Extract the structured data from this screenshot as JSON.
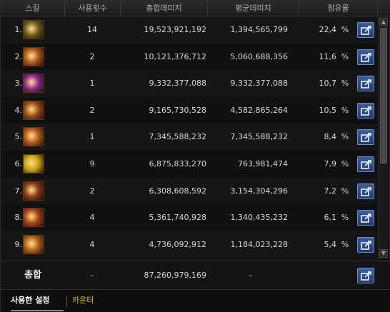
{
  "header": {
    "skill": "스킬",
    "count": "사용횟수",
    "total": "총합데미지",
    "avg": "평균데미지",
    "share": "점유율"
  },
  "rows": [
    {
      "rank": "1.",
      "count": "14",
      "total": "19,523,921,192",
      "avg": "1,394,565,799",
      "share": "22,4",
      "pct": "%",
      "icon": "skill-1-icon",
      "color": "#6b5a1a"
    },
    {
      "rank": "2.",
      "count": "2",
      "total": "10,121,376,712",
      "avg": "5,060,688,356",
      "share": "11,6",
      "pct": "%",
      "icon": "skill-2-icon",
      "color": "#b0561a"
    },
    {
      "rank": "3.",
      "count": "1",
      "total": "9,332,377,088",
      "avg": "9,332,377,088",
      "share": "10,7",
      "pct": "%",
      "icon": "skill-3-icon",
      "color": "#8a2a8a"
    },
    {
      "rank": "4.",
      "count": "2",
      "total": "9,165,730,528",
      "avg": "4,582,865,264",
      "share": "10,5",
      "pct": "%",
      "icon": "skill-4-icon",
      "color": "#9a4a14"
    },
    {
      "rank": "5.",
      "count": "1",
      "total": "7,345,588,232",
      "avg": "7,345,588,232",
      "share": "8,4",
      "pct": "%",
      "icon": "skill-5-icon",
      "color": "#b8581c"
    },
    {
      "rank": "6.",
      "count": "9",
      "total": "6,875,833,270",
      "avg": "763,981,474",
      "share": "7,9",
      "pct": "%",
      "icon": "skill-6-icon",
      "color": "#c8a41a"
    },
    {
      "rank": "7.",
      "count": "2",
      "total": "6,308,608,592",
      "avg": "3,154,304,296",
      "share": "7,2",
      "pct": "%",
      "icon": "skill-7-icon",
      "color": "#8a3a12"
    },
    {
      "rank": "8.",
      "count": "4",
      "total": "5,361,740,928",
      "avg": "1,340,435,232",
      "share": "6,1",
      "pct": "%",
      "icon": "skill-8-icon",
      "color": "#a8401a"
    },
    {
      "rank": "9.",
      "count": "4",
      "total": "4,736,092,912",
      "avg": "1,184,023,228",
      "share": "5,4",
      "pct": "%",
      "icon": "skill-9-icon",
      "color": "#b06018"
    }
  ],
  "summary": {
    "label": "총합",
    "count": "-",
    "total": "87,260,979,169",
    "avg": "-"
  },
  "tabs": {
    "used": "사용한 설정",
    "counter": "카운터"
  },
  "colors": {
    "tab_active": "#ffffff",
    "tab_counter": "#e8b32a",
    "share_button": "#2c4f8a"
  }
}
